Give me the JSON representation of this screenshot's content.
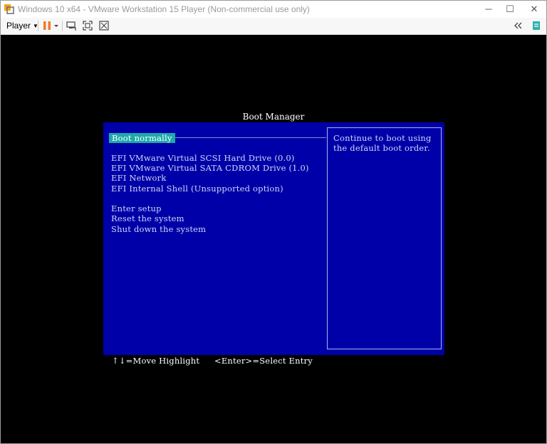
{
  "window": {
    "title": "Windows 10 x64 - VMware Workstation 15 Player (Non-commercial use only)",
    "controls": {
      "minimize": "─",
      "maximize": "☐",
      "close": "✕"
    }
  },
  "toolbar": {
    "player_label": "Player",
    "icons": [
      "pause-icon",
      "send-ctrl-alt-del-icon",
      "fullscreen-icon",
      "unity-icon",
      "back-icon",
      "notes-icon"
    ]
  },
  "boot_manager": {
    "title": "Boot Manager",
    "entries": {
      "boot_normally": "Boot normally",
      "scsi": "EFI VMware Virtual SCSI Hard Drive (0.0)",
      "sata": "EFI VMware Virtual SATA CDROM Drive (1.0)",
      "network": "EFI Network",
      "shell": "EFI Internal Shell (Unsupported option)",
      "setup": "Enter setup",
      "reset": "Reset the system",
      "shutdown": "Shut down the system"
    },
    "help_text": "Continue to boot using the default boot order.",
    "footer": {
      "move": "↑↓=Move Highlight",
      "select": "<Enter>=Select Entry"
    }
  },
  "colors": {
    "panel": "#0000a8",
    "highlight": "#1eaaaa",
    "pause_accent": "#f07a2a"
  }
}
